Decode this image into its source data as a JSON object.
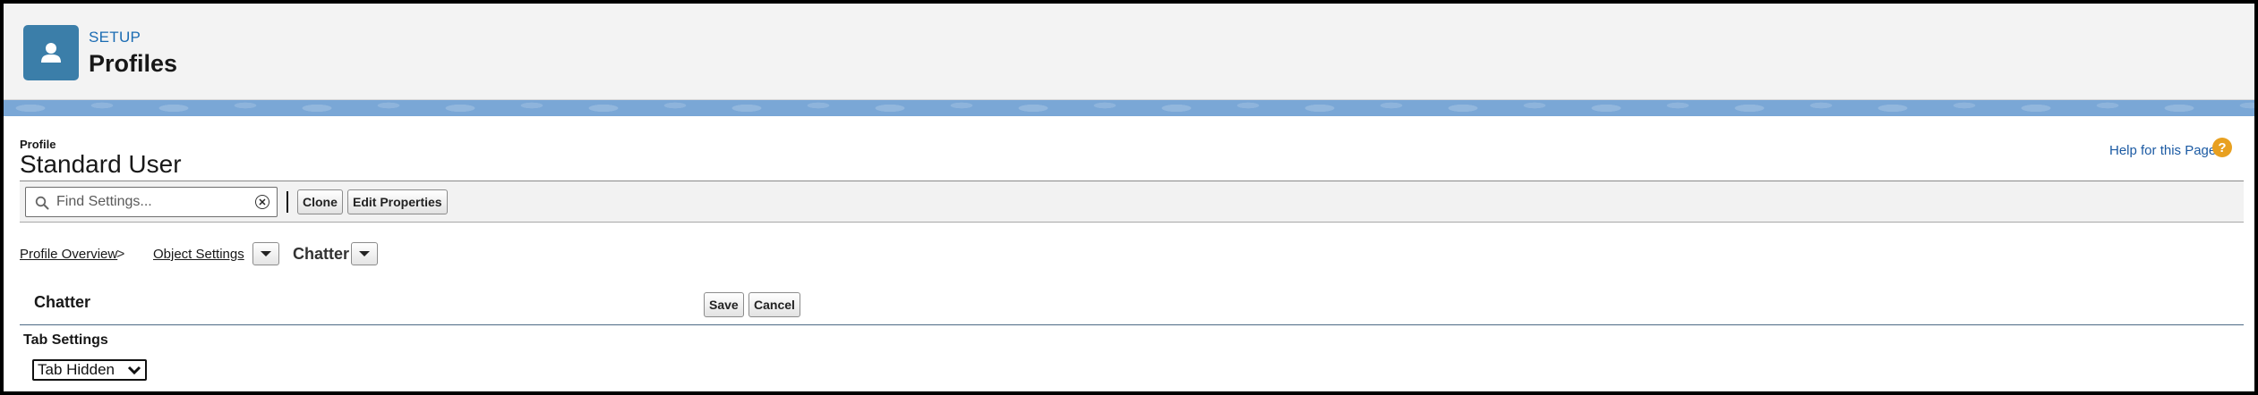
{
  "header": {
    "eyebrow": "SETUP",
    "title": "Profiles",
    "icon": "user-icon",
    "icon_bg": "#3b7ea9"
  },
  "profile": {
    "label": "Profile",
    "name": "Standard User"
  },
  "help": {
    "link_text": "Help for this Page",
    "icon_glyph": "?",
    "icon_color": "#e8a020"
  },
  "toolbar": {
    "search_placeholder": "Find Settings...",
    "search_value": "",
    "clone_label": "Clone",
    "edit_properties_label": "Edit Properties"
  },
  "breadcrumb": {
    "overview": "Profile Overview",
    "separator": ">",
    "object_settings": "Object Settings",
    "current": "Chatter"
  },
  "section": {
    "title": "Chatter",
    "save_label": "Save",
    "cancel_label": "Cancel",
    "subsection_title": "Tab Settings",
    "tab_setting_value": "Tab Hidden"
  },
  "colors": {
    "link": "#1b5aa3",
    "band": "#7aa7d6"
  }
}
